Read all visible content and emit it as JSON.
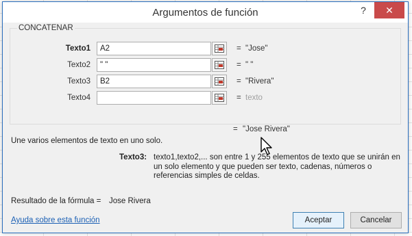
{
  "dialog": {
    "title": "Argumentos de función",
    "help_button": "?",
    "close_button": "✕"
  },
  "function_name": "CONCATENAR",
  "arguments": [
    {
      "label": "Texto1",
      "value": "A2",
      "result": "\"Jose\"",
      "bold": true
    },
    {
      "label": "Texto2",
      "value": "\" \"",
      "result": "\" \"",
      "bold": false
    },
    {
      "label": "Texto3",
      "value": "B2",
      "result": "\"Rivera\"",
      "bold": false
    },
    {
      "label": "Texto4",
      "value": "",
      "result": "texto",
      "bold": false
    }
  ],
  "equals": "=",
  "function_result": "\"Jose Rivera\"",
  "description": "Une varios elementos de texto en uno solo.",
  "param_help": {
    "name": "Texto3:",
    "text": "texto1,texto2,... son entre 1 y 255 elementos de texto que se unirán en un solo elemento y que pueden ser texto, cadenas, números o referencias simples de celdas."
  },
  "formula_result_label": "Resultado de la fórmula =",
  "formula_result_value": "Jose Rivera",
  "help_link": "Ayuda sobre esta función",
  "buttons": {
    "ok": "Aceptar",
    "cancel": "Cancelar"
  },
  "colors": {
    "accent": "#2a6ebd",
    "close": "#c94a4a",
    "link": "#1a5fb4"
  }
}
